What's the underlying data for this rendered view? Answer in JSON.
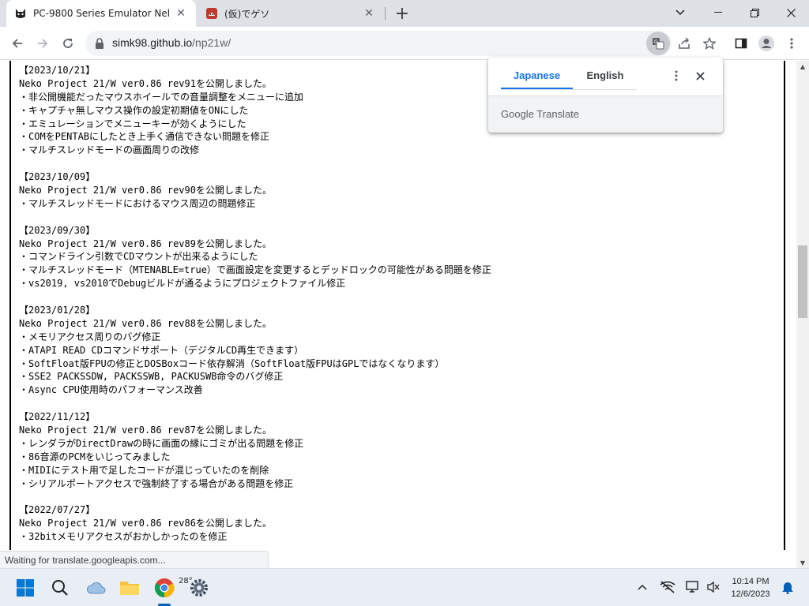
{
  "tabs": [
    {
      "title": "PC-9800 Series Emulator Neko P",
      "active": true
    },
    {
      "title": "(仮)でゲソ",
      "active": false
    }
  ],
  "window_controls": {
    "minimize": "—",
    "maximize": "☐",
    "close": "✕"
  },
  "toolbar": {
    "url_host": "simk98.github.io",
    "url_path": "/np21w/"
  },
  "translate_popup": {
    "source_lang": "Japanese",
    "target_lang": "English",
    "brand_google": "Google",
    "brand_translate": "Translate"
  },
  "log": [
    {
      "date": "【2023/10/21】",
      "lines": [
        "Neko Project 21/W ver0.86 rev91を公開しました。",
        "・非公開機能だったマウスホイールでの音量調整をメニューに追加",
        "・キャプチャ無しマウス操作の設定初期値をONにした",
        "・エミュレーションでメニューキーが効くようにした",
        "・COMをPENTABにしたとき上手く通信できない問題を修正",
        "・マルチスレッドモードの画面周りの改修"
      ]
    },
    {
      "date": "【2023/10/09】",
      "lines": [
        "Neko Project 21/W ver0.86 rev90を公開しました。",
        "・マルチスレッドモードにおけるマウス周辺の問題修正"
      ]
    },
    {
      "date": "【2023/09/30】",
      "lines": [
        "Neko Project 21/W ver0.86 rev89を公開しました。",
        "・コマンドライン引数でCDマウントが出来るようにした",
        "・マルチスレッドモード（MTENABLE=true）で画面設定を変更するとデッドロックの可能性がある問題を修正",
        "・vs2019, vs2010でDebugビルドが通るようにプロジェクトファイル修正"
      ]
    },
    {
      "date": "【2023/01/28】",
      "lines": [
        "Neko Project 21/W ver0.86 rev88を公開しました。",
        "・メモリアクセス周りのバグ修正",
        "・ATAPI READ CDコマンドサポート（デジタルCD再生できます）",
        "・SoftFloat版FPUの修正とDOSBoxコード依存解消（SoftFloat版FPUはGPLではなくなります）",
        "・SSE2 PACKSSDW, PACKSSWB, PACKUSWB命令のバグ修正",
        "・Async CPU使用時のパフォーマンス改善"
      ]
    },
    {
      "date": "【2022/11/12】",
      "lines": [
        "Neko Project 21/W ver0.86 rev87を公開しました。",
        "・レンダラがDirectDrawの時に画面の縁にゴミが出る問題を修正",
        "・86音源のPCMをいじってみました",
        "・MIDIにテスト用で足したコードが混じっていたのを削除",
        "・シリアルポートアクセスで強制終了する場合がある問題を修正"
      ]
    },
    {
      "date": "【2022/07/27】",
      "lines": [
        "Neko Project 21/W ver0.86 rev86を公開しました。",
        "・32bitメモリアクセスがおかしかったのを修正"
      ]
    }
  ],
  "scroll": {
    "position_fraction": 0.42,
    "visible_fraction": 0.15
  },
  "status_text": "Waiting for translate.googleapis.com...",
  "taskbar": {
    "weather_temp": "28°",
    "clock_time": "10:14 PM",
    "clock_date": "12/6/2023"
  },
  "colors": {
    "accent": "#1a73e8",
    "taskbar": "#e9eef5",
    "tabstrip": "#dee1e6"
  }
}
